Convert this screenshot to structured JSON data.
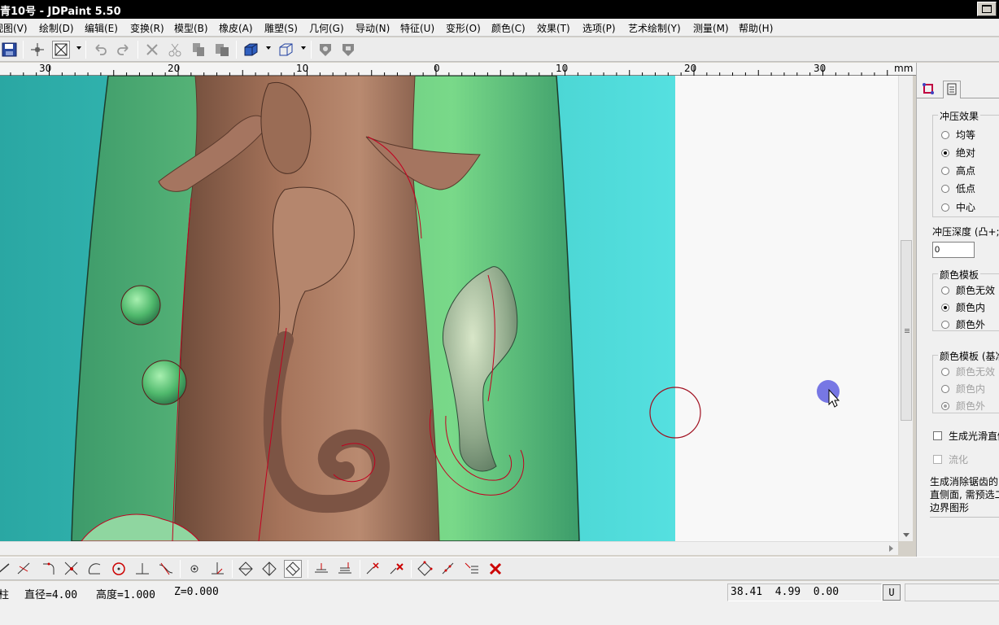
{
  "window": {
    "title": "青10号 - JDPaint 5.50"
  },
  "menu": [
    "视图(V)",
    "绘制(D)",
    "编辑(E)",
    "变换(R)",
    "模型(B)",
    "橡皮(A)",
    "雕塑(S)",
    "几何(G)",
    "导动(N)",
    "特征(U)",
    "变形(O)",
    "颜色(C)",
    "效果(T)",
    "选项(P)",
    "艺术绘制(Y)",
    "测量(M)",
    "帮助(H)"
  ],
  "ruler": {
    "labels": [
      "30",
      "20",
      "10",
      "0",
      "10",
      "20",
      "30"
    ],
    "unit": "mm"
  },
  "panel": {
    "group1": {
      "title": "冲压效果",
      "options": [
        "均等",
        "绝对",
        "高点",
        "低点",
        "中心"
      ],
      "selected": "绝对"
    },
    "depth": {
      "label": "冲压深度 (凸+;凹",
      "value": "0"
    },
    "group2": {
      "title": "颜色模板",
      "options": [
        "颜色无效",
        "颜色内",
        "颜色外"
      ],
      "selected": "颜色内"
    },
    "group3": {
      "title": "颜色模板 (基准",
      "options": [
        "颜色无效",
        "颜色内",
        "颜色外"
      ],
      "selected": "颜色外"
    },
    "smooth_check": "生成光滑直侧",
    "flow_check": "流化",
    "description": [
      "生成消除锯齿的",
      "直侧面, 需预选二",
      "边界图形"
    ]
  },
  "status": {
    "tool": "柱",
    "diameter": "直径=4.00",
    "height": "高度=1.000",
    "z": "Z=0.000",
    "coords": "38.41  4.99  0.00",
    "unit_button": "U"
  },
  "colors": {
    "accent_red": "#c00018",
    "relief_bg": "#3fcbc8",
    "relief_green": "#6ad37a",
    "relief_brown": "#9a6b52"
  }
}
